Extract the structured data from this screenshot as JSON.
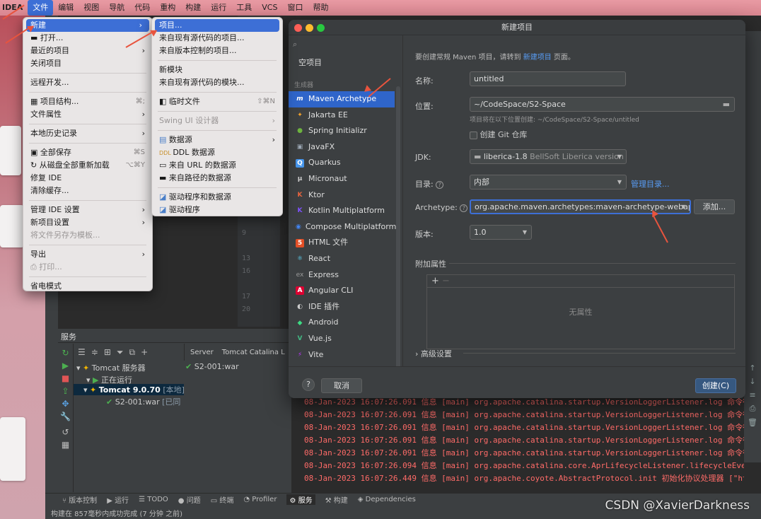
{
  "menubar": {
    "brand": "IDEA",
    "items": [
      "文件",
      "编辑",
      "视图",
      "导航",
      "代码",
      "重构",
      "构建",
      "运行",
      "工具",
      "VCS",
      "窗口",
      "帮助"
    ]
  },
  "file_menu": {
    "items": [
      {
        "label": "新建",
        "arrow": "›"
      },
      {
        "label": "打开...",
        "icon": "folder-icon"
      },
      {
        "label": "最近的项目",
        "arrow": "›"
      },
      {
        "label": "关闭项目"
      },
      {
        "label": "远程开发..."
      },
      {
        "label": "项目结构...",
        "shortcut": "⌘;"
      },
      {
        "label": "文件属性",
        "arrow": "›"
      },
      {
        "label": "本地历史记录",
        "arrow": "›"
      },
      {
        "label": "全部保存",
        "shortcut": "⌘S"
      },
      {
        "label": "从磁盘全部重新加载",
        "shortcut": "⌥⌘Y"
      },
      {
        "label": "修复 IDE"
      },
      {
        "label": "清除缓存..."
      },
      {
        "label": "管理 IDE 设置",
        "arrow": "›"
      },
      {
        "label": "新项目设置",
        "arrow": "›"
      },
      {
        "label": "将文件另存为模板..."
      },
      {
        "label": "导出",
        "arrow": "›"
      },
      {
        "label": "打印..."
      },
      {
        "label": "省电模式"
      }
    ]
  },
  "new_submenu": {
    "items": [
      {
        "label": "项目..."
      },
      {
        "label": "来自现有源代码的项目..."
      },
      {
        "label": "来自版本控制的项目..."
      },
      {
        "label": "新模块"
      },
      {
        "label": "来自现有源代码的模块..."
      },
      {
        "label": "临时文件",
        "shortcut": "⇧⌘N"
      },
      {
        "label": "Swing UI 设计器",
        "arrow": "›"
      },
      {
        "label": "数据源",
        "arrow": "›"
      },
      {
        "label": "DDL 数据源"
      },
      {
        "label": "来自 URL 的数据源"
      },
      {
        "label": "来自路径的数据源"
      },
      {
        "label": "驱动程序和数据源"
      },
      {
        "label": "驱动程序"
      }
    ]
  },
  "dialog": {
    "title": "新建项目",
    "search_placeholder": "",
    "empty_project": "空项目",
    "generators_header": "生成器",
    "generators": [
      {
        "label": "Maven Archetype",
        "icon": "m",
        "color": "#2f65ca"
      },
      {
        "label": "Jakarta EE",
        "icon": "✦",
        "color": "#f4a22a"
      },
      {
        "label": "Spring Initializr",
        "icon": "●",
        "color": "#6db33f"
      },
      {
        "label": "JavaFX",
        "icon": "▣",
        "color": "#9aa5b1"
      },
      {
        "label": "Quarkus",
        "icon": "Q",
        "color": "#4695eb"
      },
      {
        "label": "Micronaut",
        "icon": "μ",
        "color": "#cccccc"
      },
      {
        "label": "Ktor",
        "icon": "K",
        "color": "#e8643e"
      },
      {
        "label": "Kotlin Multiplatform",
        "icon": "K",
        "color": "#7f52ff"
      },
      {
        "label": "Compose Multiplatform",
        "icon": "◉",
        "color": "#4285f4"
      },
      {
        "label": "HTML 文件",
        "icon": "5",
        "color": "#e34f26"
      },
      {
        "label": "React",
        "icon": "⚛",
        "color": "#61dafb"
      },
      {
        "label": "Express",
        "icon": "ex",
        "color": "#9a9a9a"
      },
      {
        "label": "Angular CLI",
        "icon": "A",
        "color": "#dd0031"
      },
      {
        "label": "IDE 插件",
        "icon": "◐",
        "color": "#cccccc"
      },
      {
        "label": "Android",
        "icon": "◆",
        "color": "#3ddc84"
      },
      {
        "label": "Vue.js",
        "icon": "V",
        "color": "#42b883"
      },
      {
        "label": "Vite",
        "icon": "⚡",
        "color": "#bd34fe"
      }
    ],
    "hint_prefix": "要创建常规 Maven 项目，请转到",
    "hint_link": "新建项目",
    "hint_suffix": "页面。",
    "name_label": "名称:",
    "name_value": "untitled",
    "location_label": "位置:",
    "location_value": "~/CodeSpace/S2-Space",
    "location_hint": "项目将在以下位置创建: ~/CodeSpace/S2-Space/untitled",
    "git_label": "创建 Git 仓库",
    "jdk_label": "JDK:",
    "jdk_value": "liberica-1.8",
    "jdk_detail": "BellSoft Liberica version",
    "catalog_label": "目录:",
    "catalog_value": "内部",
    "catalog_link": "管理目录...",
    "archetype_label": "Archetype:",
    "archetype_value": "org.apache.maven.archetypes:maven-archetype-webapp",
    "add_button": "添加...",
    "version_label": "版本:",
    "version_value": "1.0",
    "extra_props_label": "附加属性",
    "no_props": "无属性",
    "advanced_label": "高级设置",
    "help_button": "?",
    "cancel_button": "取消",
    "create_button": "创建(C)"
  },
  "editor": {
    "line_numbers": [
      "9",
      "13",
      "16",
      "17",
      "20"
    ]
  },
  "services": {
    "title": "服务",
    "tree": [
      {
        "label": "Tomcat 服务器"
      },
      {
        "label": "正在运行"
      },
      {
        "label": "Tomcat 9.0.70",
        "suffix": "[本地]"
      },
      {
        "label": "S2-001:war",
        "suffix": "[已同"
      }
    ],
    "tabs": [
      "Server",
      "Tomcat Catalina L"
    ],
    "deploy_item": "S2-001:war"
  },
  "log_lines": [
    "08-Jan-2023 16:07:26.091 信息 [main] org.apache.catalina.startup.VersionLoggerListener.log 命令行",
    "08-Jan-2023 16:07:26.091 信息 [main] org.apache.catalina.startup.VersionLoggerListener.log 命令行",
    "08-Jan-2023 16:07:26.091 信息 [main] org.apache.catalina.startup.VersionLoggerListener.log 命令行",
    "08-Jan-2023 16:07:26.091 信息 [main] org.apache.catalina.startup.VersionLoggerListener.log 命令行",
    "08-Jan-2023 16:07:26.091 信息 [main] org.apache.catalina.startup.VersionLoggerListener.log 命令行",
    "08-Jan-2023 16:07:26.094 信息 [main] org.apache.catalina.core.AprLifecycleListener.lifecycleEve",
    "08-Jan-2023 16:07:26.449 信息 [main] org.apache.coyote.AbstractProtocol.init 初始化协议处理器 [\"ht"
  ],
  "bottom_tabs": [
    "版本控制",
    "运行",
    "TODO",
    "问题",
    "终端",
    "Profiler",
    "服务",
    "构建",
    "Dependencies"
  ],
  "status_text": "构建在 857毫秒内成功完成 (7 分钟 之前)",
  "watermark": "CSDN @XavierDarkness",
  "accent": "#3d6fd6",
  "annotation_color": "#e8543e"
}
